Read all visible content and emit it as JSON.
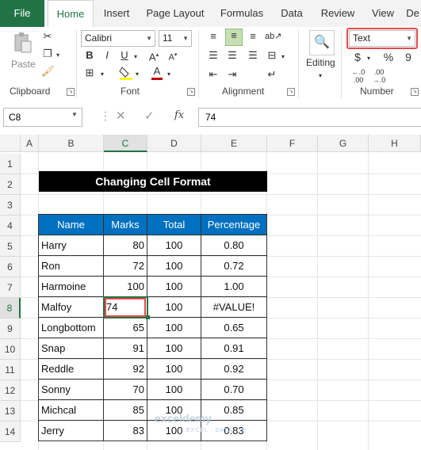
{
  "ribbon": {
    "tabs": [
      "File",
      "Home",
      "Insert",
      "Page Layout",
      "Formulas",
      "Data",
      "Review",
      "View",
      "De"
    ],
    "active_tab": "Home",
    "groups": {
      "clipboard": "Clipboard",
      "font": "Font",
      "alignment": "Alignment",
      "number": "Number"
    },
    "paste_label": "Paste",
    "font_name": "Calibri",
    "font_size": "11",
    "editing_label": "Editing",
    "number_format": "Text",
    "buttons": {
      "bold": "B",
      "italic": "I",
      "underline": "U",
      "currency": "$",
      "percent": "%",
      "comma": "9"
    }
  },
  "formula_bar": {
    "name_box": "C8",
    "fx": "fx",
    "value": "74"
  },
  "columns": [
    "A",
    "B",
    "C",
    "D",
    "E",
    "F",
    "G",
    "H"
  ],
  "selected_column": "C",
  "rows": [
    "1",
    "2",
    "3",
    "4",
    "5",
    "6",
    "7",
    "8",
    "9",
    "10",
    "11",
    "12",
    "13",
    "14"
  ],
  "selected_row": "8",
  "sheet": {
    "title": "Changing Cell Format",
    "headers": [
      "Name",
      "Marks",
      "Total",
      "Percentage"
    ],
    "data": [
      [
        "Harry",
        "80",
        "100",
        "0.80"
      ],
      [
        "Ron",
        "72",
        "100",
        "0.72"
      ],
      [
        "Harmoine",
        "100",
        "100",
        "1.00"
      ],
      [
        "Malfoy",
        "74",
        "100",
        "#VALUE!"
      ],
      [
        "Longbottom",
        "65",
        "100",
        "0.65"
      ],
      [
        "Snap",
        "91",
        "100",
        "0.91"
      ],
      [
        "Reddle",
        "92",
        "100",
        "0.92"
      ],
      [
        "Sonny",
        "70",
        "100",
        "0.70"
      ],
      [
        "Michcal",
        "85",
        "100",
        "0.85"
      ],
      [
        "Jerry",
        "83",
        "100",
        "0.83"
      ]
    ]
  },
  "watermark": {
    "name": "exceldemy",
    "tagline": "EXCEL · DATA · BI"
  },
  "colors": {
    "excel_green": "#217346",
    "header_blue": "#0070c0",
    "highlight_red": "#e84a4a"
  }
}
